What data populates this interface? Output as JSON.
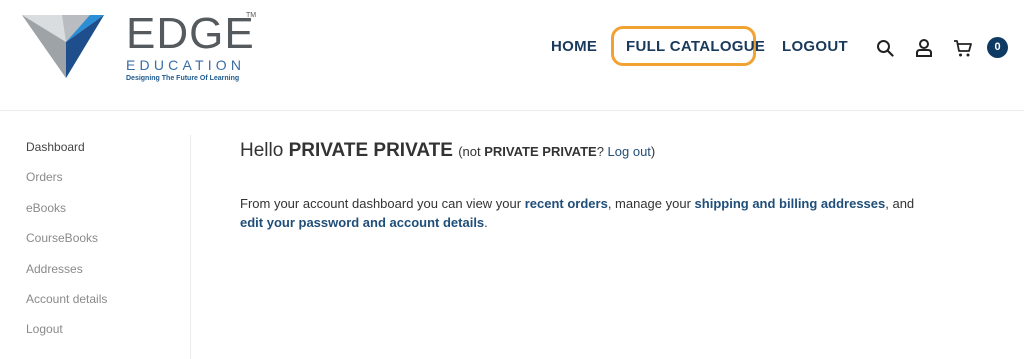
{
  "logo": {
    "name": "EDGE",
    "trademark": "TM",
    "sub": "EDUCATION",
    "tagline": "Designing The Future Of Learning"
  },
  "nav": {
    "home": "HOME",
    "catalogue": "FULL CATALOGUE",
    "logout": "LOGOUT",
    "cart_count": "0"
  },
  "icons": {
    "search": "search-icon",
    "user": "user-icon",
    "cart": "cart-icon"
  },
  "colors": {
    "brand": "#1a3a5c",
    "highlight": "#f0a233",
    "link": "#1f4e79"
  },
  "sidebar": {
    "items": [
      {
        "label": "Dashboard"
      },
      {
        "label": "Orders"
      },
      {
        "label": "eBooks"
      },
      {
        "label": "CourseBooks"
      },
      {
        "label": "Addresses"
      },
      {
        "label": "Account details"
      },
      {
        "label": "Logout"
      }
    ]
  },
  "main": {
    "hello": "Hello",
    "user_name": "PRIVATE PRIVATE",
    "paren_open": "(not",
    "paren_name": "PRIVATE PRIVATE",
    "paren_q": "?",
    "logout_link": "Log out",
    "paren_close": ")",
    "desc_1": "From your account dashboard you can view your",
    "recent_orders": "recent orders",
    "desc_2": ", manage your",
    "addresses_link": "shipping and billing addresses",
    "desc_3": ", and",
    "account_link": "edit your password and account details",
    "desc_4": "."
  }
}
